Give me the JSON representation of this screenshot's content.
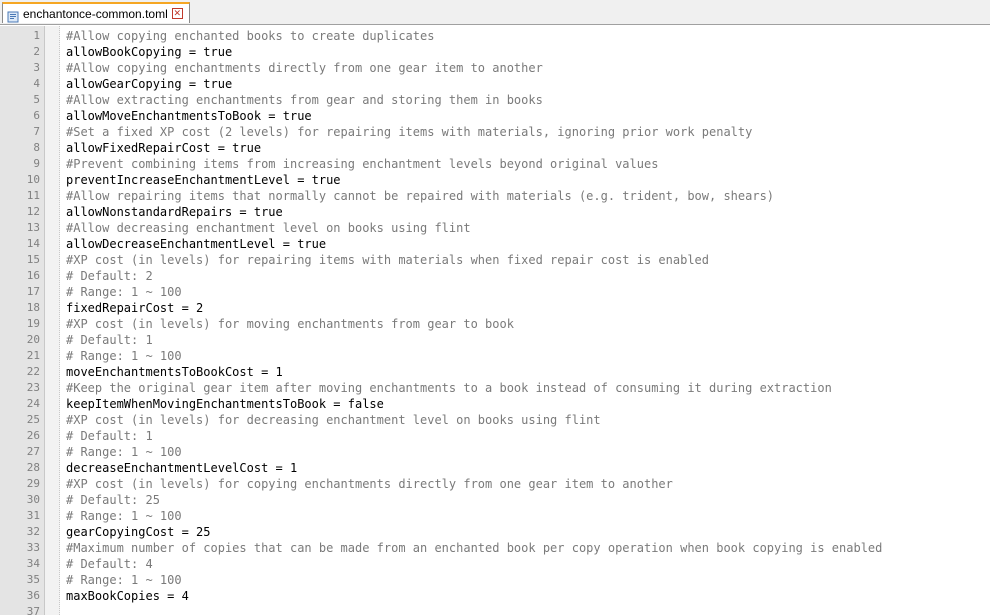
{
  "tab": {
    "filename": "enchantonce-common.toml",
    "icon": "file-icon",
    "close_icon": "close-icon"
  },
  "colors": {
    "tab_accent": "#f5a623",
    "gutter_bg": "#e4e4e4",
    "comment": "#7a7a7a",
    "code": "#000000",
    "line_number": "#808080"
  },
  "lines": [
    {
      "n": "1",
      "text": "#Allow copying enchanted books to create duplicates",
      "comment": true
    },
    {
      "n": "2",
      "text": "allowBookCopying = true",
      "comment": false
    },
    {
      "n": "3",
      "text": "#Allow copying enchantments directly from one gear item to another",
      "comment": true
    },
    {
      "n": "4",
      "text": "allowGearCopying = true",
      "comment": false
    },
    {
      "n": "5",
      "text": "#Allow extracting enchantments from gear and storing them in books",
      "comment": true
    },
    {
      "n": "6",
      "text": "allowMoveEnchantmentsToBook = true",
      "comment": false
    },
    {
      "n": "7",
      "text": "#Set a fixed XP cost (2 levels) for repairing items with materials, ignoring prior work penalty",
      "comment": true
    },
    {
      "n": "8",
      "text": "allowFixedRepairCost = true",
      "comment": false
    },
    {
      "n": "9",
      "text": "#Prevent combining items from increasing enchantment levels beyond original values",
      "comment": true
    },
    {
      "n": "10",
      "text": "preventIncreaseEnchantmentLevel = true",
      "comment": false
    },
    {
      "n": "11",
      "text": "#Allow repairing items that normally cannot be repaired with materials (e.g. trident, bow, shears)",
      "comment": true
    },
    {
      "n": "12",
      "text": "allowNonstandardRepairs = true",
      "comment": false
    },
    {
      "n": "13",
      "text": "#Allow decreasing enchantment level on books using flint",
      "comment": true
    },
    {
      "n": "14",
      "text": "allowDecreaseEnchantmentLevel = true",
      "comment": false
    },
    {
      "n": "15",
      "text": "#XP cost (in levels) for repairing items with materials when fixed repair cost is enabled",
      "comment": true
    },
    {
      "n": "16",
      "text": "# Default: 2",
      "comment": true
    },
    {
      "n": "17",
      "text": "# Range: 1 ~ 100",
      "comment": true
    },
    {
      "n": "18",
      "text": "fixedRepairCost = 2",
      "comment": false
    },
    {
      "n": "19",
      "text": "#XP cost (in levels) for moving enchantments from gear to book",
      "comment": true
    },
    {
      "n": "20",
      "text": "# Default: 1",
      "comment": true
    },
    {
      "n": "21",
      "text": "# Range: 1 ~ 100",
      "comment": true
    },
    {
      "n": "22",
      "text": "moveEnchantmentsToBookCost = 1",
      "comment": false
    },
    {
      "n": "23",
      "text": "#Keep the original gear item after moving enchantments to a book instead of consuming it during extraction",
      "comment": true
    },
    {
      "n": "24",
      "text": "keepItemWhenMovingEnchantmentsToBook = false",
      "comment": false
    },
    {
      "n": "25",
      "text": "#XP cost (in levels) for decreasing enchantment level on books using flint",
      "comment": true
    },
    {
      "n": "26",
      "text": "# Default: 1",
      "comment": true
    },
    {
      "n": "27",
      "text": "# Range: 1 ~ 100",
      "comment": true
    },
    {
      "n": "28",
      "text": "decreaseEnchantmentLevelCost = 1",
      "comment": false
    },
    {
      "n": "29",
      "text": "#XP cost (in levels) for copying enchantments directly from one gear item to another",
      "comment": true
    },
    {
      "n": "30",
      "text": "# Default: 25",
      "comment": true
    },
    {
      "n": "31",
      "text": "# Range: 1 ~ 100",
      "comment": true
    },
    {
      "n": "32",
      "text": "gearCopyingCost = 25",
      "comment": false
    },
    {
      "n": "33",
      "text": "#Maximum number of copies that can be made from an enchanted book per copy operation when book copying is enabled",
      "comment": true
    },
    {
      "n": "34",
      "text": "# Default: 4",
      "comment": true
    },
    {
      "n": "35",
      "text": "# Range: 1 ~ 100",
      "comment": true
    },
    {
      "n": "36",
      "text": "maxBookCopies = 4",
      "comment": false
    },
    {
      "n": "37",
      "text": "",
      "comment": false
    }
  ]
}
